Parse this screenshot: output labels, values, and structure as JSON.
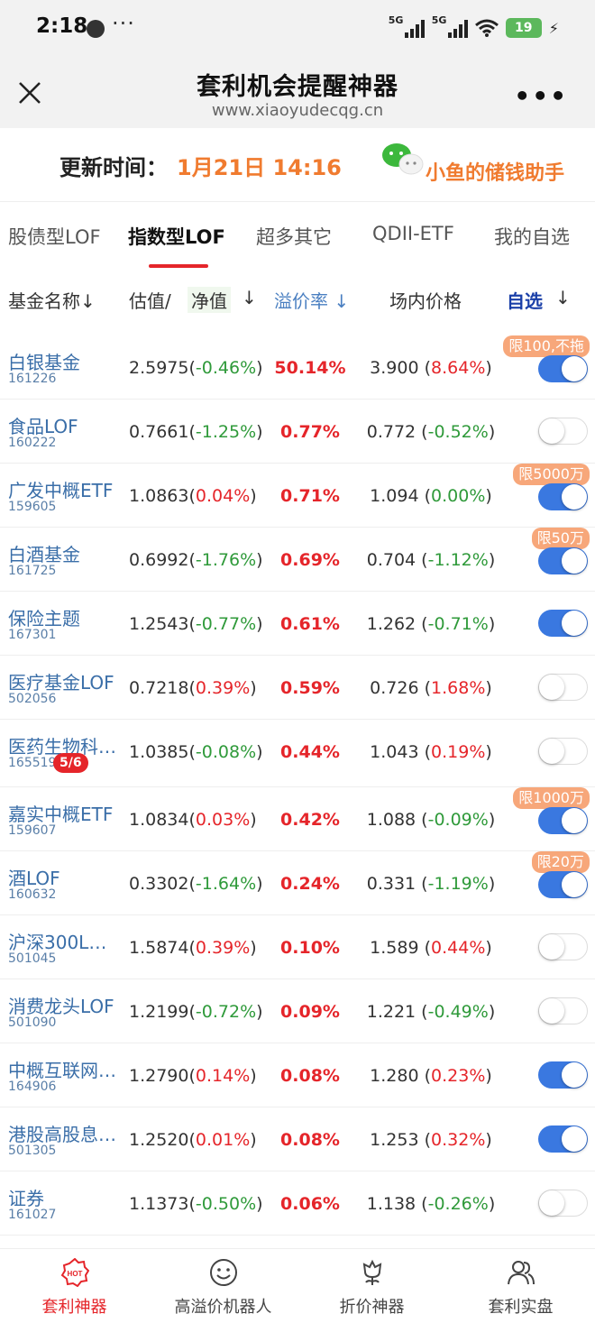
{
  "status": {
    "time": "2:18",
    "dots": "···",
    "net1": "5G",
    "net2": "5G",
    "battery": "19"
  },
  "header": {
    "title": "套利机会提醒神器",
    "url": "www.xiaoyudecqg.cn"
  },
  "update": {
    "label": "更新时间：",
    "value": "1月21日 14:16",
    "brand": "小鱼的储钱助手"
  },
  "tabs": [
    {
      "label": "股债型LOF"
    },
    {
      "label": "指数型LOF"
    },
    {
      "label": "超多其它"
    },
    {
      "label": "QDII-ETF"
    },
    {
      "label": "我的自选"
    }
  ],
  "columns": {
    "name": "基金名称↓",
    "estimate": "估值/",
    "nav": "净值",
    "arrow1": "↓",
    "premium": "溢价率 ↓",
    "market": "场内价格",
    "favorite": "自选",
    "arrow2": "↓"
  },
  "rows": [
    {
      "name": "白银基金",
      "code": "161226",
      "est": "2.5975(",
      "est_chg": "-0.46%",
      "est_dir": "down",
      "premium": "50.14%",
      "price": "3.900 (",
      "price_chg": "8.64%",
      "price_dir": "up",
      "fav": true,
      "limit": "限100,不拖"
    },
    {
      "name": "食品LOF",
      "code": "160222",
      "est": "0.7661(",
      "est_chg": "-1.25%",
      "est_dir": "down",
      "premium": "0.77%",
      "price": "0.772 (",
      "price_chg": "-0.52%",
      "price_dir": "down",
      "fav": false,
      "limit": ""
    },
    {
      "name": "广发中概ETF",
      "code": "159605",
      "est": "1.0863(",
      "est_chg": "0.04%",
      "est_dir": "up",
      "premium": "0.71%",
      "price": "1.094 (",
      "price_chg": "0.00%",
      "price_dir": "down",
      "fav": true,
      "limit": "限5000万"
    },
    {
      "name": "白酒基金",
      "code": "161725",
      "est": "0.6992(",
      "est_chg": "-1.76%",
      "est_dir": "down",
      "premium": "0.69%",
      "price": "0.704 (",
      "price_chg": "-1.12%",
      "price_dir": "down",
      "fav": true,
      "limit": "限50万"
    },
    {
      "name": "保险主题",
      "code": "167301",
      "est": "1.2543(",
      "est_chg": "-0.77%",
      "est_dir": "down",
      "premium": "0.61%",
      "price": "1.262 (",
      "price_chg": "-0.71%",
      "price_dir": "down",
      "fav": true,
      "limit": ""
    },
    {
      "name": "医疗基金LOF",
      "code": "502056",
      "est": "0.7218(",
      "est_chg": "0.39%",
      "est_dir": "up",
      "premium": "0.59%",
      "price": "0.726 (",
      "price_chg": "1.68%",
      "price_dir": "up",
      "fav": false,
      "limit": ""
    },
    {
      "name": "医药生物科…",
      "code": "165519",
      "est": "1.0385(",
      "est_chg": "-0.08%",
      "est_dir": "down",
      "premium": "0.44%",
      "price": "1.043 (",
      "price_chg": "0.19%",
      "price_dir": "up",
      "fav": false,
      "limit": "",
      "badge": "5/6"
    },
    {
      "name": "嘉实中概ETF",
      "code": "159607",
      "est": "1.0834(",
      "est_chg": "0.03%",
      "est_dir": "up",
      "premium": "0.42%",
      "price": "1.088 (",
      "price_chg": "-0.09%",
      "price_dir": "down",
      "fav": true,
      "limit": "限1000万"
    },
    {
      "name": "酒LOF",
      "code": "160632",
      "est": "0.3302(",
      "est_chg": "-1.64%",
      "est_dir": "down",
      "premium": "0.24%",
      "price": "0.331 (",
      "price_chg": "-1.19%",
      "price_dir": "down",
      "fav": true,
      "limit": "限20万"
    },
    {
      "name": "沪深300L…",
      "code": "501045",
      "est": "1.5874(",
      "est_chg": "0.39%",
      "est_dir": "up",
      "premium": "0.10%",
      "price": "1.589 (",
      "price_chg": "0.44%",
      "price_dir": "up",
      "fav": false,
      "limit": ""
    },
    {
      "name": "消费龙头LOF",
      "code": "501090",
      "est": "1.2199(",
      "est_chg": "-0.72%",
      "est_dir": "down",
      "premium": "0.09%",
      "price": "1.221 (",
      "price_chg": "-0.49%",
      "price_dir": "down",
      "fav": false,
      "limit": ""
    },
    {
      "name": "中概互联网…",
      "code": "164906",
      "est": "1.2790(",
      "est_chg": "0.14%",
      "est_dir": "up",
      "premium": "0.08%",
      "price": "1.280 (",
      "price_chg": "0.23%",
      "price_dir": "up",
      "fav": true,
      "limit": ""
    },
    {
      "name": "港股高股息…",
      "code": "501305",
      "est": "1.2520(",
      "est_chg": "0.01%",
      "est_dir": "up",
      "premium": "0.08%",
      "price": "1.253 (",
      "price_chg": "0.32%",
      "price_dir": "up",
      "fav": true,
      "limit": ""
    },
    {
      "name": "证券",
      "code": "161027",
      "est": "1.1373(",
      "est_chg": "-0.50%",
      "est_dir": "down",
      "premium": "0.06%",
      "price": "1.138 (",
      "price_chg": "-0.26%",
      "price_dir": "down",
      "fav": false,
      "limit": ""
    }
  ],
  "paren_close": ")",
  "nav": [
    {
      "label": "套利神器",
      "icon": "hot-badge-icon",
      "hot": "HOT"
    },
    {
      "label": "高溢价机器人",
      "icon": "smiley-icon"
    },
    {
      "label": "折价神器",
      "icon": "flower-icon"
    },
    {
      "label": "套利实盘",
      "icon": "users-icon"
    }
  ],
  "colors": {
    "accent": "#e5252a",
    "orange": "#f07b2f",
    "link": "#3a6ea8",
    "toggle_on": "#3a78e0",
    "up": "#e5252a",
    "down": "#2f9a3a"
  }
}
